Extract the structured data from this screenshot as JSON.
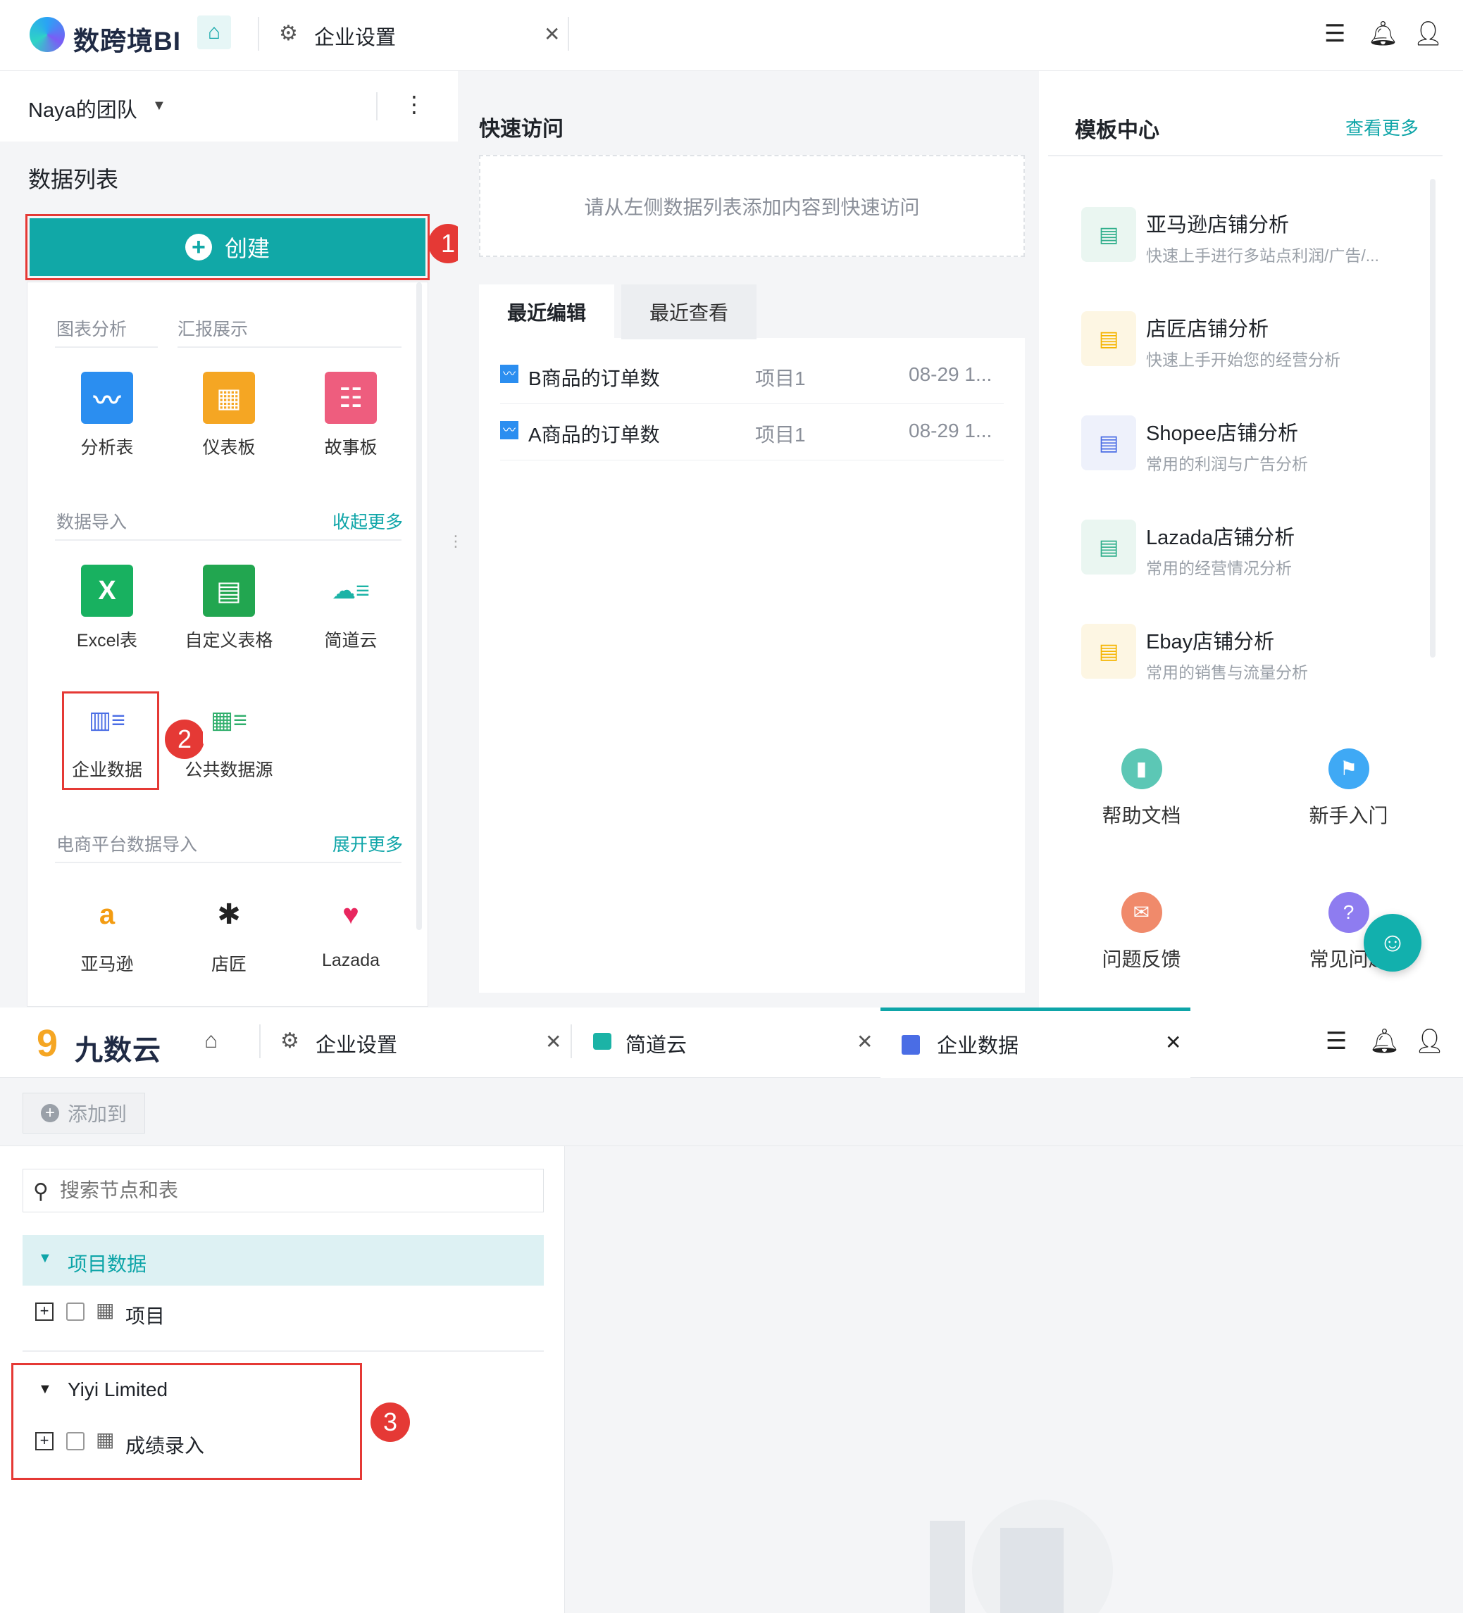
{
  "top": {
    "app_name": "数跨境BI",
    "tabs": [
      {
        "label": "企业设置"
      }
    ],
    "icons": [
      "list-icon",
      "bell-icon",
      "user-icon"
    ]
  },
  "left": {
    "team": "Naya的团队",
    "list_title": "数据列表",
    "create_label": "创建",
    "sections": {
      "chart_tab1": "图表分析",
      "chart_tab2": "汇报展示",
      "items1": [
        {
          "label": "分析表"
        },
        {
          "label": "仪表板"
        },
        {
          "label": "故事板"
        }
      ],
      "import_title": "数据导入",
      "import_link": "收起更多",
      "items2": [
        {
          "label": "Excel表"
        },
        {
          "label": "自定义表格"
        },
        {
          "label": "简道云"
        },
        {
          "label": "企业数据"
        },
        {
          "label": "公共数据源"
        }
      ],
      "ecom_title": "电商平台数据导入",
      "ecom_link": "展开更多",
      "items3": [
        {
          "label": "亚马逊"
        },
        {
          "label": "店匠"
        },
        {
          "label": "Lazada"
        }
      ]
    }
  },
  "badges": [
    "1",
    "2",
    "3"
  ],
  "quick": {
    "title": "快速访问",
    "empty": "请从左侧数据列表添加内容到快速访问"
  },
  "recent": {
    "tabs": [
      "最近编辑",
      "最近查看"
    ],
    "rows": [
      {
        "name": "B商品的订单数",
        "project": "项目1",
        "time": "08-29 1..."
      },
      {
        "name": "A商品的订单数",
        "project": "项目1",
        "time": "08-29 1..."
      }
    ]
  },
  "templates": {
    "title": "模板中心",
    "more": "查看更多",
    "items": [
      {
        "name": "亚马逊店铺分析",
        "desc": "快速上手进行多站点利润/广告/..."
      },
      {
        "name": "店匠店铺分析",
        "desc": "快速上手开始您的经营分析"
      },
      {
        "name": "Shopee店铺分析",
        "desc": "常用的利润与广告分析"
      },
      {
        "name": "Lazada店铺分析",
        "desc": "常用的经营情况分析"
      },
      {
        "name": "Ebay店铺分析",
        "desc": "常用的销售与流量分析"
      }
    ]
  },
  "tiles": [
    {
      "label": "帮助文档"
    },
    {
      "label": "新手入门"
    },
    {
      "label": "问题反馈"
    },
    {
      "label": "常见问题"
    }
  ],
  "bottom": {
    "app_name": "九数云",
    "tabs": [
      {
        "label": "企业设置"
      },
      {
        "label": "简道云"
      },
      {
        "label": "企业数据"
      }
    ],
    "add_label": "添加到",
    "search_placeholder": "搜索节点和表",
    "group1": "项目数据",
    "item1": "项目",
    "group2": "Yiyi Limited",
    "item2": "成绩录入"
  },
  "colors": {
    "accent": "#0ea5a8",
    "badge": "#e53935"
  }
}
